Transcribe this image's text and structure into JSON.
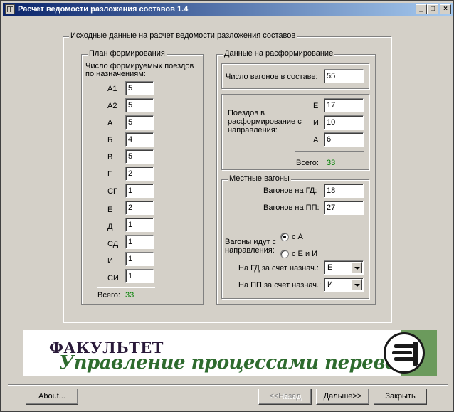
{
  "window": {
    "title": "Расчет ведомости разложения составов 1.4",
    "btn_min": "_",
    "btn_max": "□",
    "btn_close": "×"
  },
  "main_group": {
    "title": "Исходные данные на расчет ведомости разложения составов"
  },
  "plan": {
    "title": "План формирования",
    "subtitle_1": "Число формируемых поездов",
    "subtitle_2": "по назначениям:",
    "rows": [
      {
        "label": "А1",
        "value": "5"
      },
      {
        "label": "А2",
        "value": "5"
      },
      {
        "label": "А",
        "value": "5"
      },
      {
        "label": "Б",
        "value": "4"
      },
      {
        "label": "В",
        "value": "5"
      },
      {
        "label": "Г",
        "value": "2"
      },
      {
        "label": "СГ",
        "value": "1"
      },
      {
        "label": "Е",
        "value": "2"
      },
      {
        "label": "Д",
        "value": "1"
      },
      {
        "label": "СД",
        "value": "1"
      },
      {
        "label": "И",
        "value": "1"
      },
      {
        "label": "СИ",
        "value": "1"
      }
    ],
    "total_label": "Всего:",
    "total_value": "33"
  },
  "disband": {
    "title": "Данные на расформирование",
    "wagons_label": "Число вагонов в составе:",
    "wagons_value": "55",
    "trains_text_1": "Поездов в",
    "trains_text_2": "расформирование с",
    "trains_text_3": "направления:",
    "trains": [
      {
        "label": "Е",
        "value": "17"
      },
      {
        "label": "И",
        "value": "10"
      },
      {
        "label": "А",
        "value": "6"
      }
    ],
    "total_label": "Всего:",
    "total_value": "33"
  },
  "local": {
    "title": "Местные вагоны",
    "gd_label": "Вагонов на ГД:",
    "gd_value": "18",
    "pp_label": "Вагонов на ПП:",
    "pp_value": "27",
    "direction_text_1": "Вагоны идут с",
    "direction_text_2": "направления:",
    "radio_a": "с А",
    "radio_ei": "с Е и И",
    "gd_dest_label": "На ГД за счет назнач.:",
    "gd_dest_value": "Е",
    "pp_dest_label": "На ПП за счет назнач.:",
    "pp_dest_value": "И"
  },
  "banner": {
    "line1": "ФАКУЛЬТЕТ",
    "line2": "Управление процессами перевозок"
  },
  "buttons": {
    "about": "About...",
    "back": "<<Назад",
    "next": "Дальше>>",
    "close": "Закрыть"
  }
}
